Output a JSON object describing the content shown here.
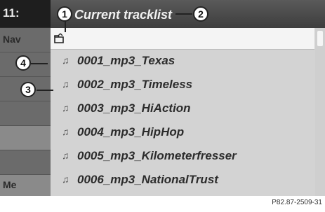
{
  "background": {
    "time": "11:",
    "nav_label": "Nav",
    "media_label": "Me"
  },
  "overlay": {
    "title": "Current tracklist",
    "tracks": [
      {
        "name": "0001_mp3_Texas"
      },
      {
        "name": "0002_mp3_Timeless"
      },
      {
        "name": "0003_mp3_HiAction"
      },
      {
        "name": "0004_mp3_HipHop"
      },
      {
        "name": "0005_mp3_Kilometerfresser"
      },
      {
        "name": "0006_mp3_NationalTrust"
      }
    ]
  },
  "callouts": {
    "c1": "1",
    "c2": "2",
    "c3": "3",
    "c4": "4"
  },
  "figure_code": "P82.87-2509-31",
  "icons": {
    "folder": "folder-up-icon",
    "note": "music-note-icon"
  }
}
